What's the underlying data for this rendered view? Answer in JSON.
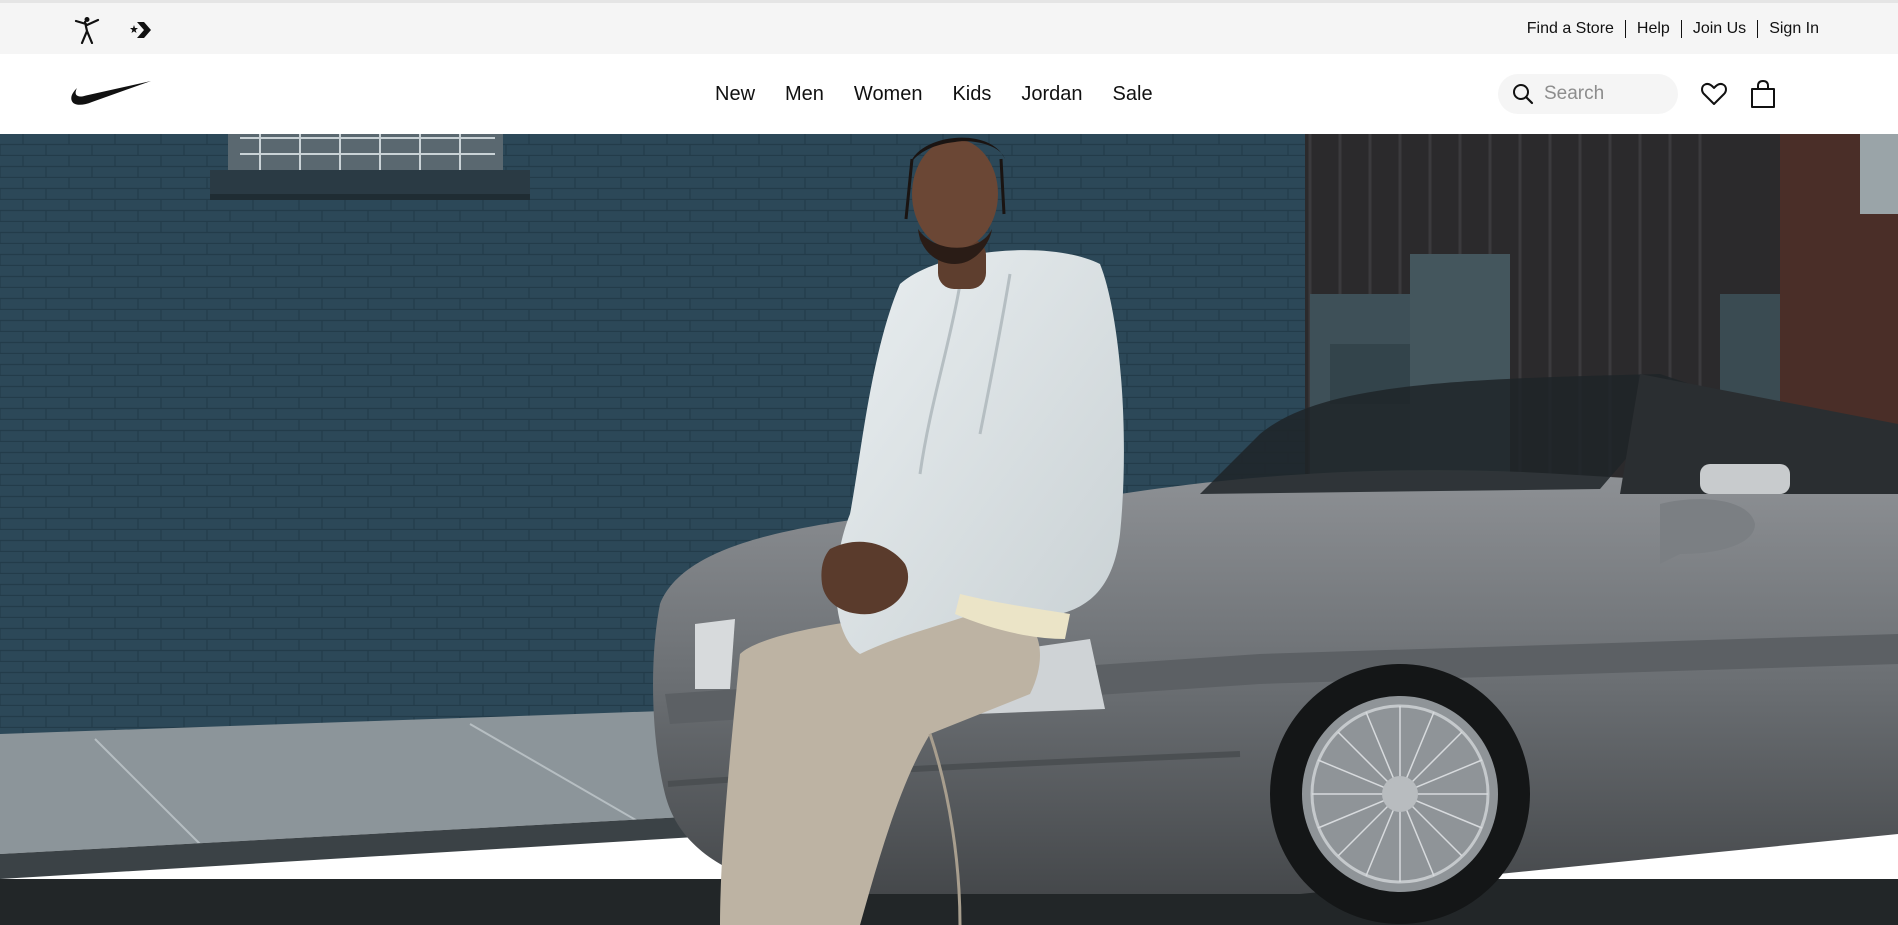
{
  "brand_bar": {
    "icons": [
      "jordan-jumpman-icon",
      "converse-star-chevron-icon"
    ]
  },
  "utility_links": [
    "Find a Store",
    "Help",
    "Join Us",
    "Sign In"
  ],
  "logo": "nike-swoosh-icon",
  "nav": {
    "items": [
      "New",
      "Men",
      "Women",
      "Kids",
      "Jordan",
      "Sale"
    ]
  },
  "search": {
    "placeholder": "Search",
    "icon": "search-icon"
  },
  "actions": {
    "favorites_icon": "heart-icon",
    "bag_icon": "bag-icon"
  },
  "hero": {
    "image": "man-in-white-jacket-sitting-on-silver-convertible-by-blue-brick-wall"
  },
  "colors": {
    "utility_bg": "#f5f5f5",
    "text": "#111111",
    "placeholder": "#8d8d8d",
    "wall": "#2f4d5e"
  }
}
